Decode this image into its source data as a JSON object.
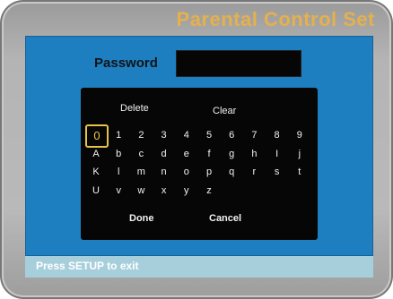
{
  "screen": {
    "title": "Parental Control Set",
    "password_label": "Password",
    "password_value": ""
  },
  "keyboard": {
    "delete_label": "Delete",
    "clear_label": "Clear",
    "rows": [
      [
        "0",
        "1",
        "2",
        "3",
        "4",
        "5",
        "6",
        "7",
        "8",
        "9"
      ],
      [
        "A",
        "b",
        "c",
        "d",
        "e",
        "f",
        "g",
        "h",
        "I",
        "j"
      ],
      [
        "K",
        "l",
        "m",
        "n",
        "o",
        "p",
        "q",
        "r",
        "s",
        "t"
      ],
      [
        "U",
        "v",
        "w",
        "x",
        "y",
        "z"
      ]
    ],
    "focused_key": "0",
    "done_label": "Done",
    "cancel_label": "Cancel"
  },
  "status": {
    "hint": "Press SETUP to exit"
  },
  "colors": {
    "title": "#e5b04e",
    "panel": "#1e7fc0",
    "focus": "#e8c34a",
    "status_bar": "#a7cfdb"
  }
}
